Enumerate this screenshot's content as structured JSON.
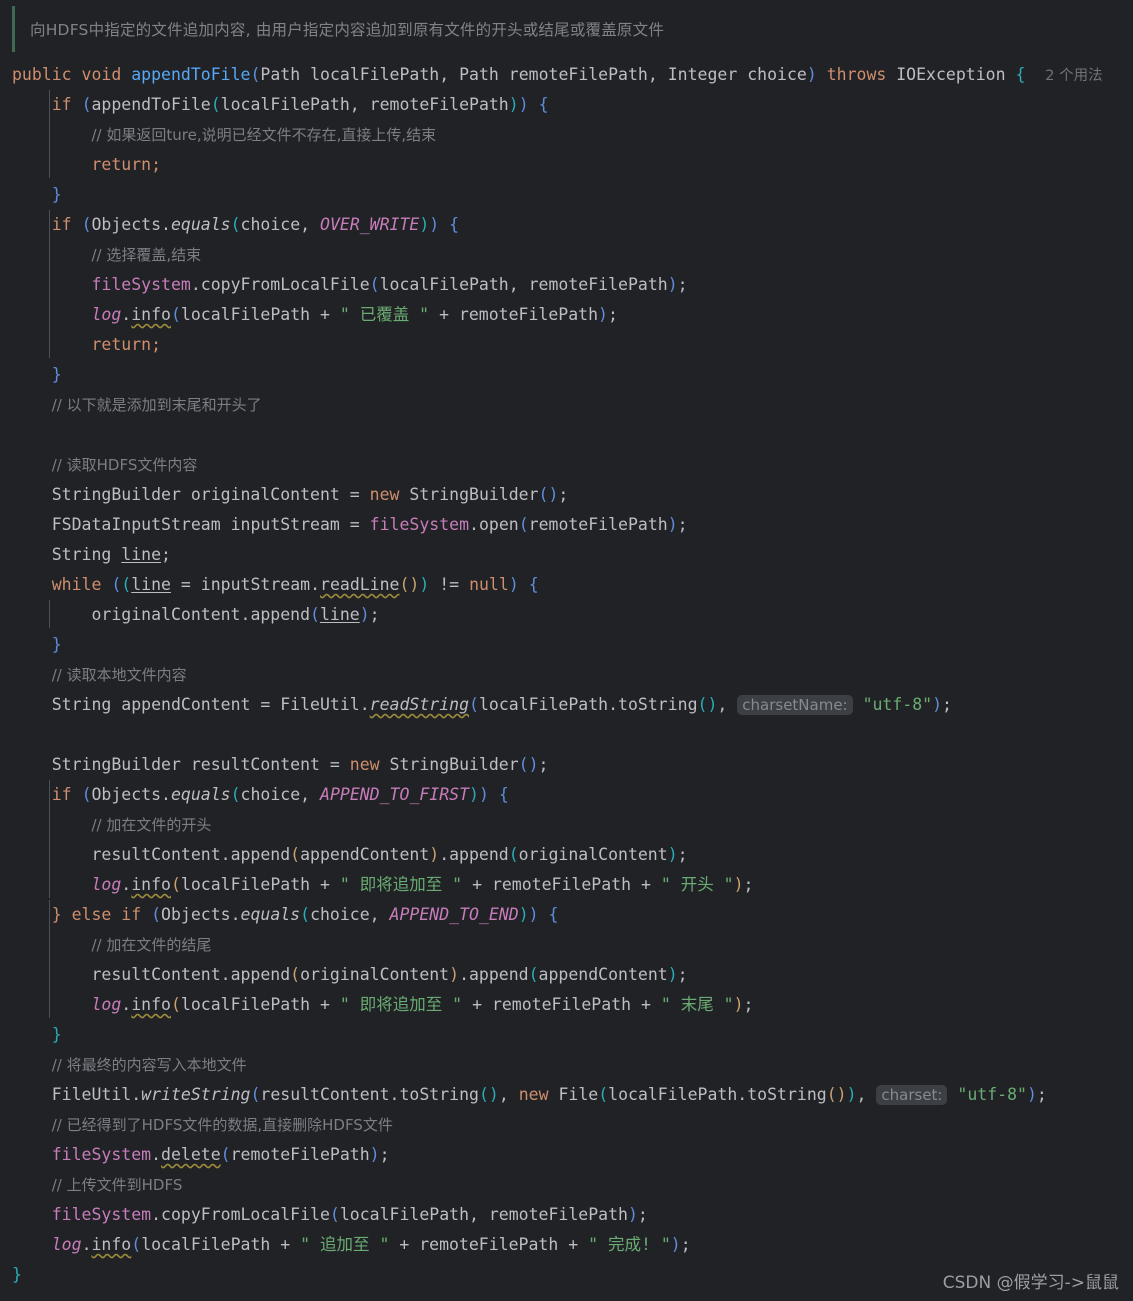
{
  "editor": {
    "language": "java",
    "theme": "dark",
    "background_color": "#212225",
    "default_text_color": "#bcbec4"
  },
  "doc_comment": {
    "text": "向HDFS中指定的文件追加内容, 由用户指定内容追加到原有文件的开头或结尾或覆盖原文件",
    "accent_color": "#3f6b52"
  },
  "signature": {
    "modifier": "public",
    "return_type": "void",
    "name": "appendToFile",
    "params_open": "(",
    "p1_type": "Path",
    "p1_name": "localFilePath",
    "sep1": ", ",
    "p2_type": "Path",
    "p2_name": "remoteFilePath",
    "sep2": ", ",
    "p3_type": "Integer",
    "p3_name": "choice",
    "params_close": ")",
    "throws_kw": "throws",
    "exception": "IOException",
    "open_brace": "{",
    "usages_hint": "2 个用法"
  },
  "hints": {
    "charset_name": "charsetName:",
    "charset": "charset:"
  },
  "strings": {
    "utf8": "\"utf-8\"",
    "overwritten": "\" 已覆盖 \"",
    "about_to_append": "\" 即将追加至 \"",
    "head": "\" 开头 \"",
    "tail": "\" 末尾 \"",
    "append_to": "\" 追加至 \"",
    "done": "\" 完成! \""
  },
  "comments": {
    "c1": "// 如果返回ture,说明已经文件不存在,直接上传,结束",
    "c2": "// 选择覆盖,结束",
    "c3": "// 以下就是添加到末尾和开头了",
    "c4": "// 读取HDFS文件内容",
    "c5": "// 读取本地文件内容",
    "c6": "// 加在文件的开头",
    "c7": "// 加在文件的结尾",
    "c8": "// 将最终的内容写入本地文件",
    "c9": "// 已经得到了HDFS文件的数据,直接删除HDFS文件",
    "c10": "// 上传文件到HDFS"
  },
  "keywords": {
    "if": "if",
    "else_if": "} else if",
    "while": "while",
    "new": "new",
    "return": "return;",
    "null": "null"
  },
  "identifiers": {
    "objects": "Objects",
    "equals": "equals",
    "choice": "choice",
    "over_write": "OVER_WRITE",
    "append_to_first": "APPEND_TO_FIRST",
    "append_to_end": "APPEND_TO_END",
    "file_system": "fileSystem",
    "log": "log",
    "info": "info",
    "copy_from_local_file": "copyFromLocalFile",
    "local_file_path": "localFilePath",
    "remote_file_path": "remoteFilePath",
    "string_builder": "StringBuilder",
    "original_content": "originalContent",
    "result_content": "resultContent",
    "append_content": "appendContent",
    "fsdata_input_stream": "FSDataInputStream",
    "input_stream": "inputStream",
    "open": "open",
    "string": "String",
    "line": "line",
    "read_line": "readLine",
    "append": "append",
    "file_util": "FileUtil",
    "read_string": "readString",
    "write_string": "writeString",
    "to_string": "toString",
    "file": "File",
    "delete": "delete",
    "append_to_file": "appendToFile"
  },
  "watermark": {
    "text": "CSDN @假学习->鼠鼠"
  }
}
